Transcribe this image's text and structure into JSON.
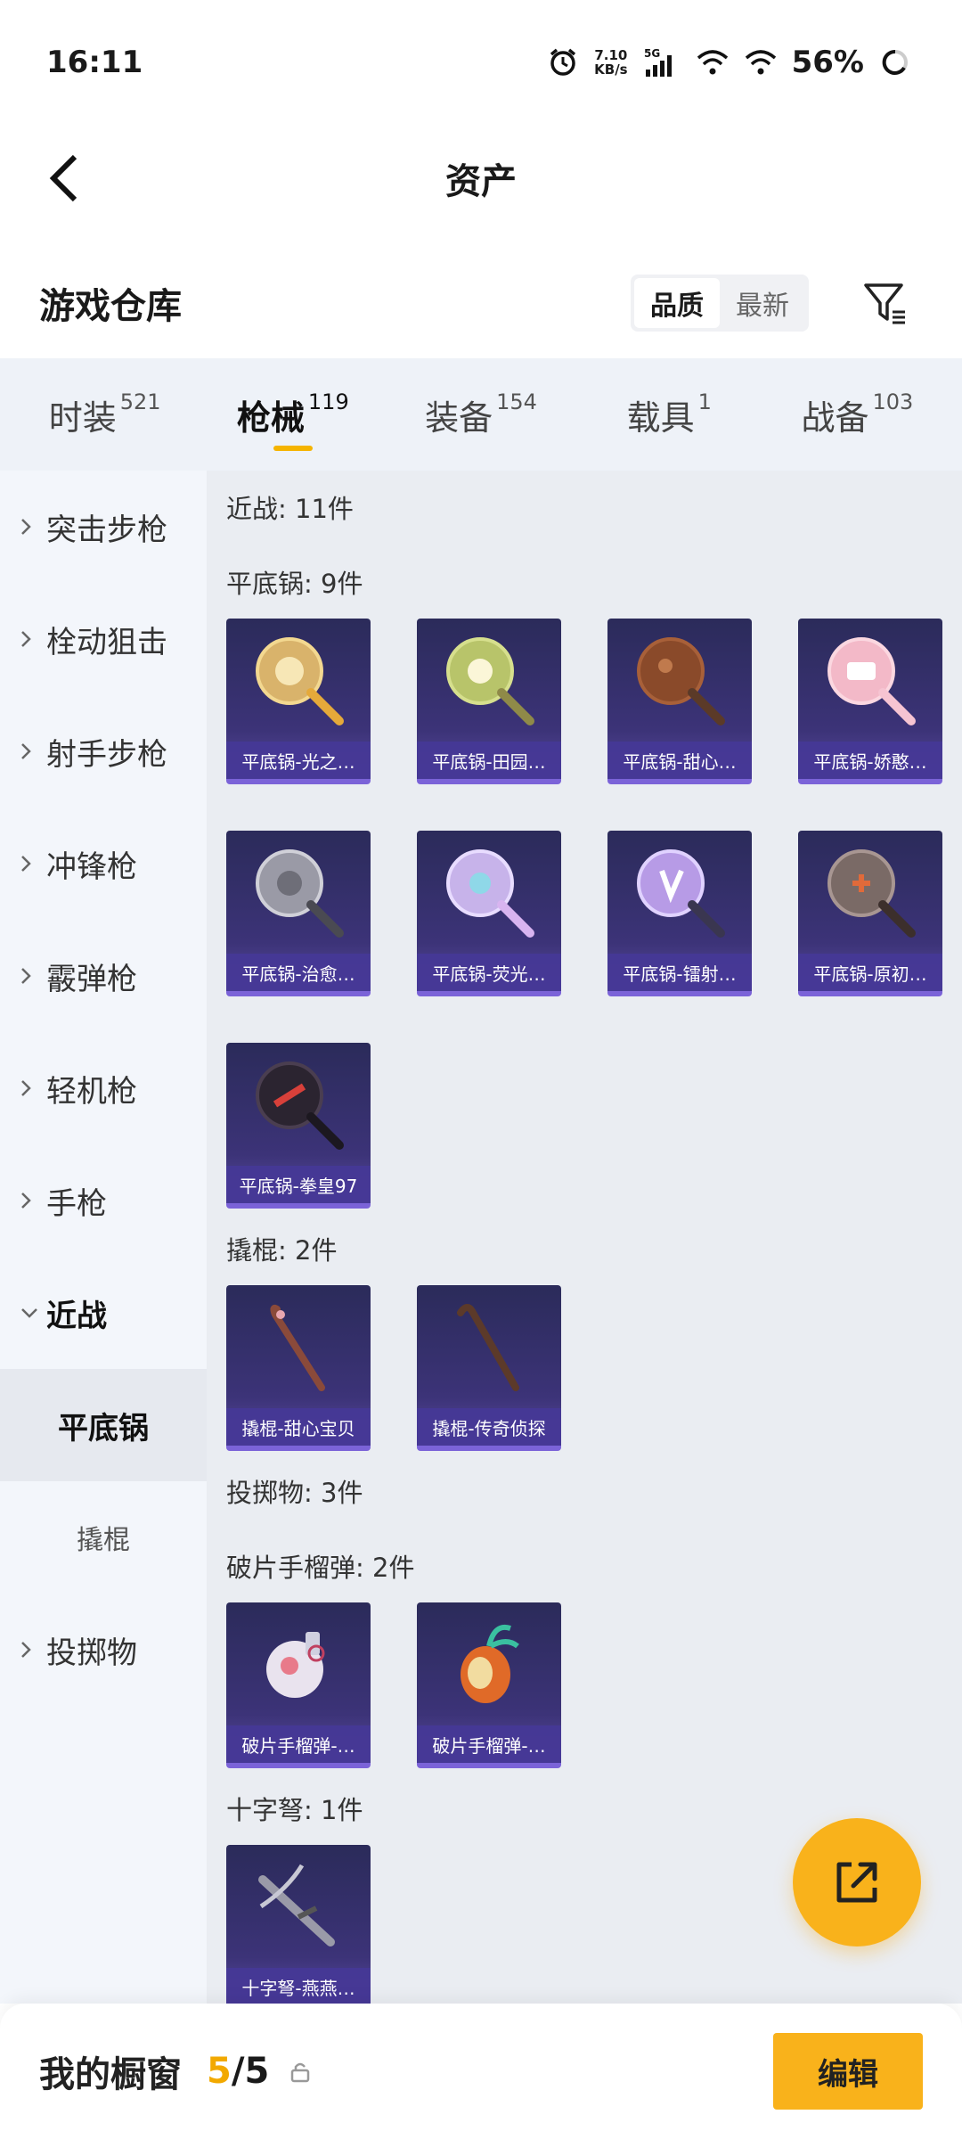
{
  "status_bar": {
    "time": "16:11",
    "net_speed_value": "7.10",
    "net_speed_unit": "KB/s",
    "network": "5G",
    "battery": "56%"
  },
  "header": {
    "title": "资产"
  },
  "warehouse": {
    "title": "游戏仓库",
    "sort_options": [
      "品质",
      "最新"
    ],
    "active_sort": "品质"
  },
  "tabs": [
    {
      "label": "时装",
      "count": "521"
    },
    {
      "label": "枪械",
      "count": "119"
    },
    {
      "label": "装备",
      "count": "154"
    },
    {
      "label": "载具",
      "count": "1"
    },
    {
      "label": "战备",
      "count": "103"
    }
  ],
  "active_tab": "枪械",
  "sidebar": {
    "items": [
      {
        "label": "突击步枪"
      },
      {
        "label": "栓动狙击"
      },
      {
        "label": "射手步枪"
      },
      {
        "label": "冲锋枪"
      },
      {
        "label": "霰弹枪"
      },
      {
        "label": "轻机枪"
      },
      {
        "label": "手枪"
      },
      {
        "label": "近战"
      },
      {
        "label": "投掷物"
      }
    ],
    "sub_items": [
      {
        "label": "平底锅"
      },
      {
        "label": "撬棍"
      }
    ]
  },
  "content": {
    "sections": {
      "melee": "近战: 11件",
      "pan": "平底锅: 9件",
      "crowbar": "撬棍: 2件",
      "throwable": "投掷物: 3件",
      "frag": "破片手榴弹: 2件",
      "crossbow": "十字弩: 1件"
    },
    "pan_items": [
      "平底锅-光之…",
      "平底锅-田园…",
      "平底锅-甜心…",
      "平底锅-娇憨…",
      "平底锅-治愈…",
      "平底锅-荧光…",
      "平底锅-镭射…",
      "平底锅-原初…",
      "平底锅-拳皇97"
    ],
    "crowbar_items": [
      "撬棍-甜心宝贝",
      "撬棍-传奇侦探"
    ],
    "frag_items": [
      "破片手榴弹-…",
      "破片手榴弹-…"
    ],
    "crossbow_items": [
      "十字弩-燕燕…"
    ]
  },
  "bottom_bar": {
    "title": "我的橱窗",
    "count_current": "5",
    "count_total": "/5",
    "edit_label": "编辑"
  },
  "colors": {
    "accent": "#f9b21b",
    "card_bg": "#3c3378",
    "card_label_bg": "#4638a0"
  }
}
